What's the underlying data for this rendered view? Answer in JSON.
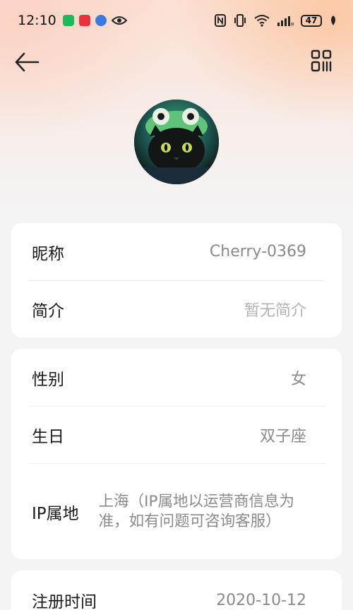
{
  "status_bar": {
    "time": "12:10",
    "battery": "47",
    "icons": [
      "wechat-icon",
      "notification-icon",
      "music-icon",
      "eye-icon",
      "nfc-icon",
      "vibrate-icon",
      "wifi-icon",
      "signal-icon",
      "leaf-icon"
    ]
  },
  "nav": {
    "back_icon": "arrow-left-icon",
    "qr_icon": "qr-code-icon"
  },
  "profile": {
    "avatar": "avatar-cat-frog-hat"
  },
  "section_basic": {
    "rows": [
      {
        "label": "昵称",
        "value": "Cherry-0369"
      },
      {
        "label": "简介",
        "value": "暂无简介"
      }
    ]
  },
  "section_personal": {
    "rows": [
      {
        "label": "性别",
        "value": "女"
      },
      {
        "label": "生日",
        "value": "双子座"
      },
      {
        "label": "IP属地",
        "value": "上海（IP属地以运营商信息为准，如有问题可咨询客服）"
      }
    ]
  },
  "section_account": {
    "rows": [
      {
        "label": "注册时间",
        "value": "2020-10-12"
      }
    ]
  },
  "colors": {
    "page_bg": "#f4f4f4",
    "card_bg": "#ffffff",
    "gradient_peach": "#fbc9a6",
    "label_text": "#1a1a1a",
    "value_text": "#8a8a8a",
    "placeholder_text": "#b3b3b3"
  }
}
